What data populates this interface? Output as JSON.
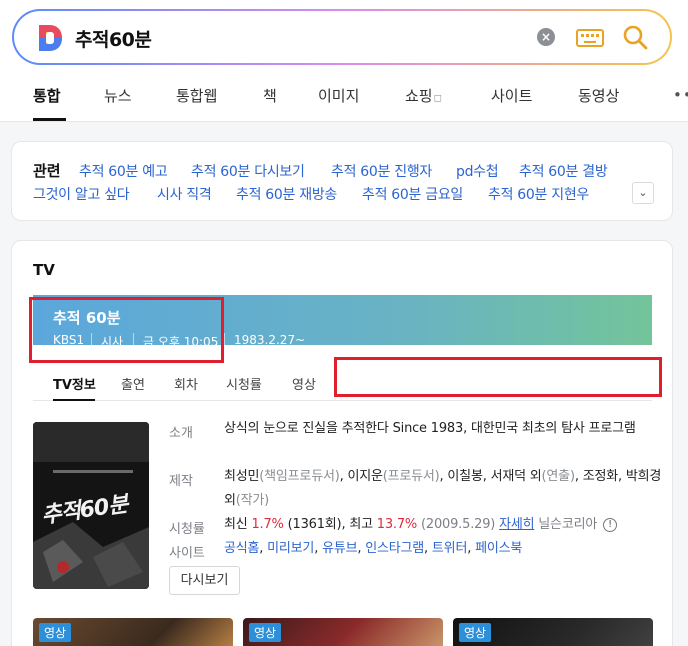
{
  "search": {
    "query": "추적60분"
  },
  "tabs": [
    "통합",
    "뉴스",
    "통합웹",
    "책",
    "이미지",
    "쇼핑",
    "사이트",
    "동영상"
  ],
  "related": {
    "title": "관련",
    "row1": [
      "추적 60분 예고",
      "추적 60분 다시보기",
      "추적 60분 진행자",
      "pd수첩",
      "추적 60분 결방"
    ],
    "row2": [
      "그것이 알고 싶다",
      "시사 직격",
      "추적 60분 재방송",
      "추적 60분 금요일",
      "추적 60분 지현우"
    ]
  },
  "tv": {
    "label": "TV",
    "program_title": "추적 60분",
    "channel": "KBS1",
    "genre": "시사",
    "airtime": "금 오후 10:05",
    "start_date": "1983.2.27~",
    "subtabs": [
      "TV정보",
      "출연",
      "회차",
      "시청률",
      "영상"
    ],
    "poster_text": "추적60분",
    "info": {
      "intro_label": "소개",
      "intro": "상식의 눈으로 진실을 추적한다 Since 1983, 대한민국 최초의 탐사 프로그램",
      "staff_label": "제작",
      "staff": [
        {
          "name": "최성민",
          "role": "(책임프로듀서)"
        },
        {
          "name": "이지운",
          "role": "(프로듀서)"
        },
        {
          "name": "이칠봉, 서재덕 외",
          "role": "(연출)"
        },
        {
          "name": "조정화, 박희경 외",
          "role": "(작가)"
        }
      ],
      "rating_label": "시청률",
      "rating_latest_prefix": "최신",
      "rating_latest": "1.7%",
      "rating_latest_ep": "(1361회)",
      "rating_max_prefix": "최고",
      "rating_max": "13.7%",
      "rating_max_date": "(2009.5.29)",
      "rating_more": "자세히",
      "rating_source": "닐슨코리아",
      "sites_label": "사이트",
      "sites": [
        "공식홈",
        "미리보기",
        "유튜브",
        "인스타그램",
        "트위터",
        "페이스북"
      ]
    },
    "replay_button": "다시보기",
    "video_badge": "영상"
  }
}
